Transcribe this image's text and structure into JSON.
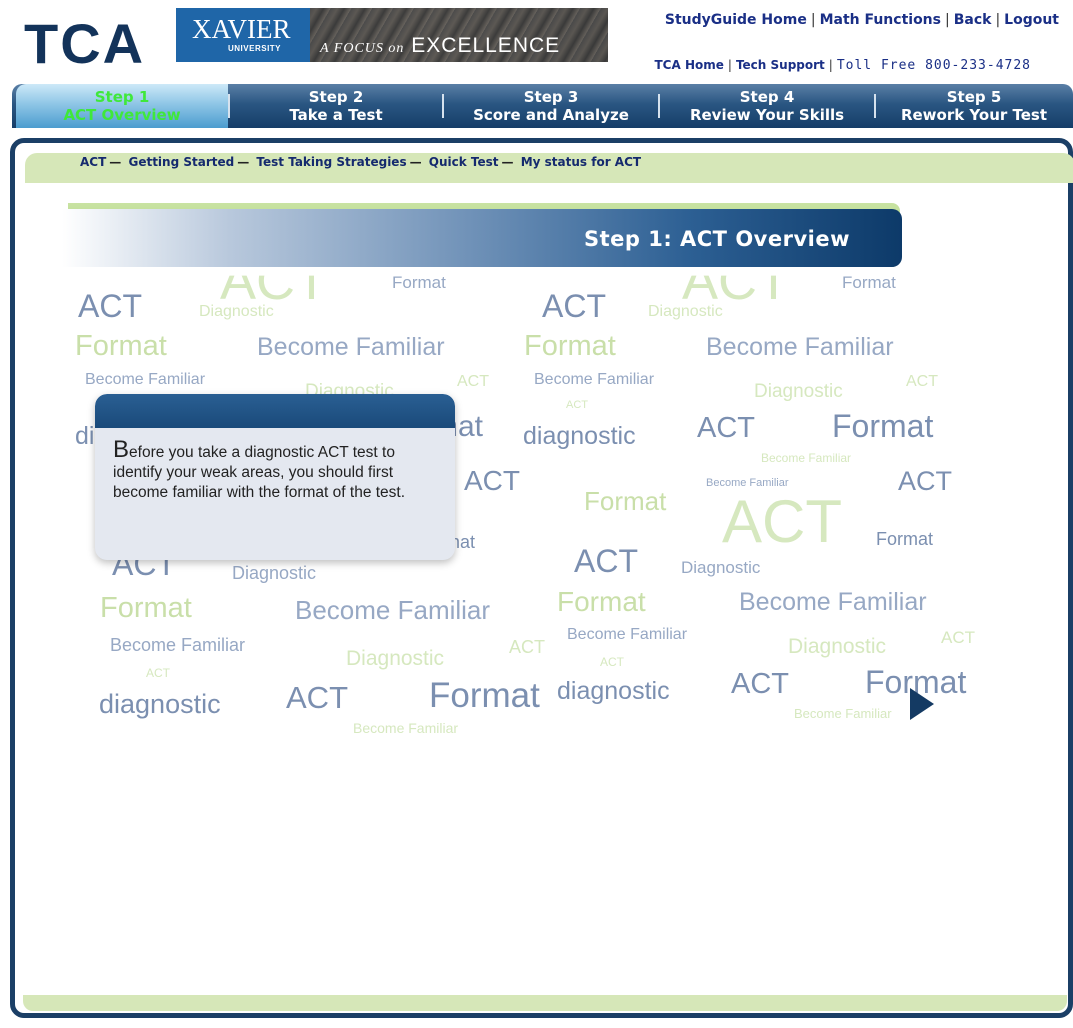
{
  "header": {
    "logo": "TCA",
    "university": "XAVIER",
    "university_sub": "UNIVERSITY",
    "tagline_small": "A FOCUS on",
    "tagline_big": "EXCELLENCE",
    "top_links": [
      "StudyGuide Home",
      "Math Functions",
      "Back",
      "Logout"
    ],
    "sub_links": [
      "TCA Home",
      "Tech Support"
    ],
    "toll_free": "Toll Free 800-233-4728"
  },
  "steps": [
    {
      "num": "Step 1",
      "label": "ACT Overview",
      "active": true
    },
    {
      "num": "Step 2",
      "label": "Take a Test",
      "active": false
    },
    {
      "num": "Step 3",
      "label": "Score and Analyze",
      "active": false
    },
    {
      "num": "Step 4",
      "label": "Review Your Skills",
      "active": false
    },
    {
      "num": "Step 5",
      "label": "Rework Your Test",
      "active": false
    }
  ],
  "breadcrumb": {
    "root": "ACT",
    "items": [
      "Getting Started",
      "Test Taking Strategies",
      "Quick Test",
      "My status for ACT"
    ]
  },
  "main": {
    "title": "Step 1:  ACT Overview"
  },
  "popup": {
    "first_letter": "B",
    "text": "efore you take a diagnostic ACT test to identify your weak areas, you should first become familiar with the format of the test."
  },
  "cloud_words": {
    "act": "ACT",
    "format": "Format",
    "diagnostic_cap": "Diagnostic",
    "diagnostic": "diagnostic",
    "become_familiar": "Become Familiar"
  },
  "colors": {
    "navy": "#13335a",
    "step_active_text": "#3fe83a",
    "frame_green": "#d6e7b8"
  }
}
